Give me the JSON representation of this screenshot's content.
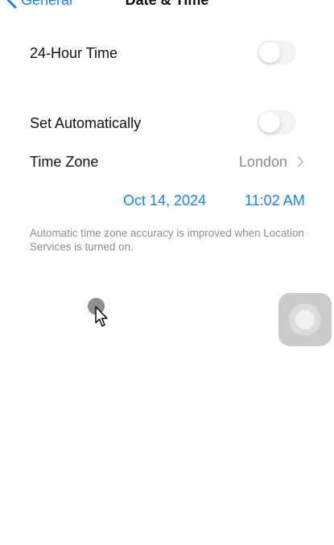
{
  "nav": {
    "back_label": "General",
    "title": "Date & Time"
  },
  "settings": {
    "hour24": {
      "label": "24-Hour Time",
      "enabled": false
    },
    "set_automatically": {
      "label": "Set Automatically",
      "enabled": false
    },
    "time_zone": {
      "label": "Time Zone",
      "value": "London"
    },
    "date": "Oct 14, 2024",
    "time": "11:02 AM",
    "footnote": "Automatic time zone accuracy is improved when Location Services is turned on."
  },
  "colors": {
    "accent": "#1a82f7",
    "secondary_text": "#8d8d92",
    "background": "#ffffff"
  },
  "icons": {
    "back": "chevron-left-icon",
    "disclosure": "chevron-right-icon",
    "pointer": "mouse-pointer-icon",
    "assistive_touch": "assistive-touch-icon"
  }
}
